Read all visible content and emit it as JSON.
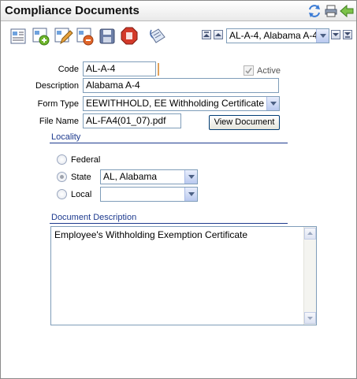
{
  "window": {
    "title": "Compliance Documents"
  },
  "record_selector": {
    "value": "AL-A-4, Alabama A-4"
  },
  "form": {
    "code_label": "Code",
    "code_value": "AL-A-4",
    "active_label": "Active",
    "active_checked": true,
    "description_label": "Description",
    "description_value": "Alabama A-4",
    "form_type_label": "Form Type",
    "form_type_value": "EEWITHHOLD, EE Withholding Certificate",
    "file_name_label": "File Name",
    "file_name_value": "AL-FA4(01_07).pdf",
    "view_document_label": "View Document"
  },
  "locality": {
    "title": "Locality",
    "federal_label": "Federal",
    "state_label": "State",
    "state_value": "AL, Alabama",
    "local_label": "Local",
    "local_value": "",
    "selected": "State"
  },
  "document_description": {
    "title": "Document Description",
    "text": "Employee's Withholding Exemption Certificate"
  },
  "icons": {
    "titlebar": [
      "refresh-icon",
      "print-icon",
      "back-arrow-icon"
    ],
    "toolbar": [
      "view-list-icon",
      "add-record-icon",
      "edit-record-icon",
      "delete-record-icon",
      "save-icon",
      "stop-icon",
      "attach-icon"
    ],
    "navigation": [
      "first-record-icon",
      "previous-record-icon",
      "next-record-icon",
      "last-record-icon"
    ]
  },
  "colors": {
    "section_title": "#1d3a8e",
    "input_border": "#7f9db9",
    "accent_green": "#6fb52c",
    "accent_red": "#d33a2a"
  }
}
